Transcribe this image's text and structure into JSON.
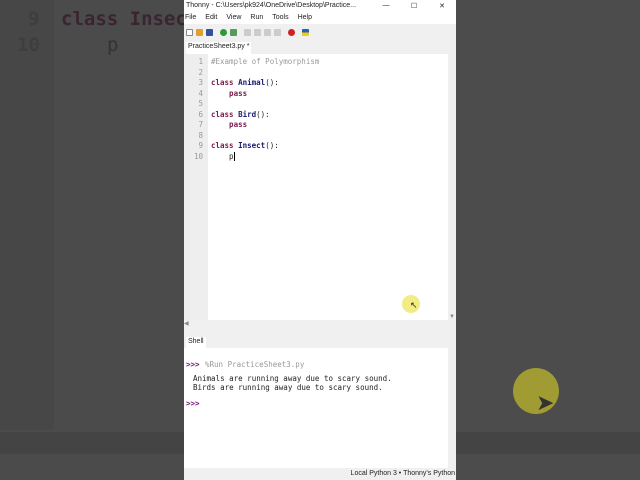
{
  "background": {
    "line_numbers": [
      "9",
      "10"
    ],
    "code": [
      "class Insec",
      "p"
    ]
  },
  "window": {
    "title": "Thonny  -  C:\\Users\\pk924\\OneDrive\\Desktop\\Practice...",
    "controls": [
      "—",
      "☐",
      "✕"
    ]
  },
  "menu": [
    "File",
    "Edit",
    "View",
    "Run",
    "Tools",
    "Help"
  ],
  "editor": {
    "tab": "PracticeSheet3.py *",
    "lines": [
      {
        "n": "1",
        "parts": [
          [
            "cm",
            "#Example of Polymorphism"
          ]
        ]
      },
      {
        "n": "2",
        "parts": []
      },
      {
        "n": "3",
        "parts": [
          [
            "kw",
            "class "
          ],
          [
            "nm",
            "Animal"
          ],
          [
            "",
            "():"
          ]
        ]
      },
      {
        "n": "4",
        "parts": [
          [
            "kw",
            "    pass"
          ]
        ]
      },
      {
        "n": "5",
        "parts": []
      },
      {
        "n": "6",
        "parts": [
          [
            "kw",
            "class "
          ],
          [
            "nm",
            "Bird"
          ],
          [
            "",
            "():"
          ]
        ]
      },
      {
        "n": "7",
        "parts": [
          [
            "kw",
            "    pass"
          ]
        ]
      },
      {
        "n": "8",
        "parts": []
      },
      {
        "n": "9",
        "parts": [
          [
            "kw",
            "class "
          ],
          [
            "nm",
            "Insect"
          ],
          [
            "",
            "():"
          ]
        ]
      },
      {
        "n": "10",
        "parts": [
          [
            "",
            "    p"
          ]
        ]
      }
    ]
  },
  "shell": {
    "tab": "Shell",
    "prompt": ">>>",
    "command": "%Run PracticeSheet3.py",
    "output": [
      "Animals are running away due to scary sound.",
      "Birds are running away due to scary sound."
    ]
  },
  "status": "Local Python 3  •  Thonny's Python"
}
